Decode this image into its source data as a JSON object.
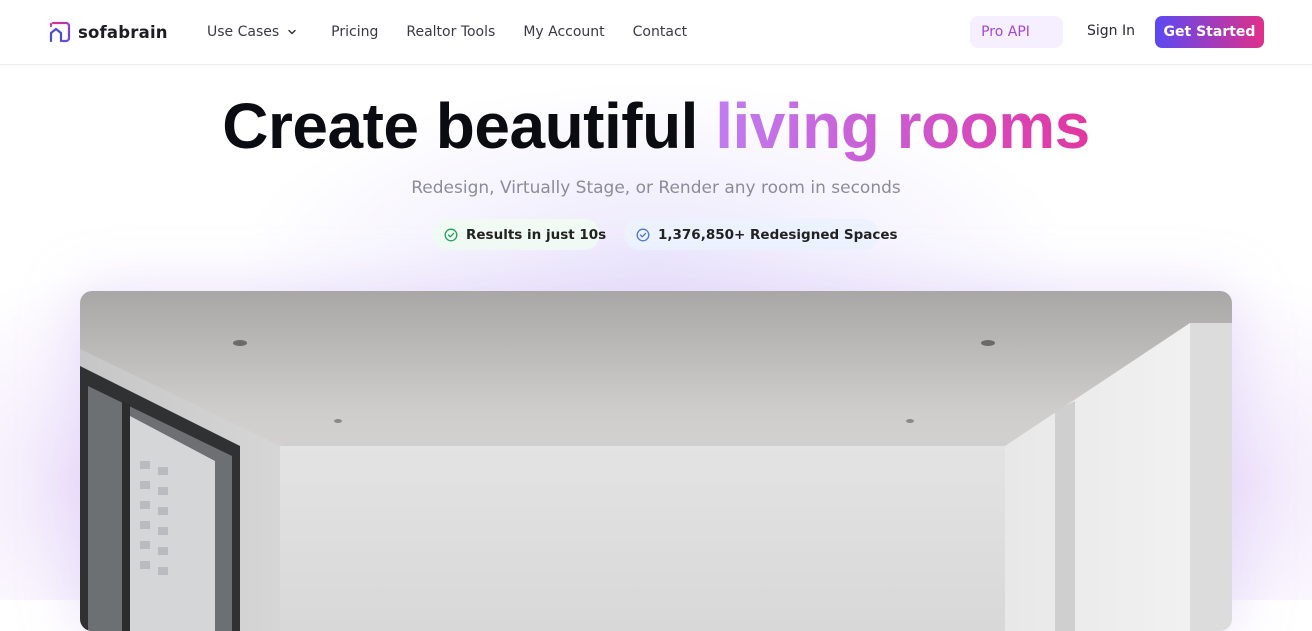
{
  "brand": {
    "name": "sofabrain",
    "logo_icon": "house-logo-icon",
    "accent": "#5a49f2",
    "accent_end": "#e0308a"
  },
  "nav": {
    "items": [
      {
        "label": "Use Cases",
        "has_dropdown": true
      },
      {
        "label": "Pricing"
      },
      {
        "label": "Realtor Tools"
      },
      {
        "label": "My Account"
      },
      {
        "label": "Contact"
      }
    ],
    "pro_api": "Pro API",
    "sign_in": "Sign In",
    "get_started": "Get Started"
  },
  "hero": {
    "title_plain": "Create beautiful",
    "title_highlight": "living rooms",
    "subtitle": "Redesign, Virtually Stage, or Render any room in seconds",
    "badges": [
      {
        "icon": "check-circle-icon",
        "label": "Results in just 10s",
        "color": "#22a35a"
      },
      {
        "icon": "check-circle-icon",
        "label": "1,376,850+ Redesigned Spaces",
        "color": "#4a78d8"
      }
    ],
    "image": "empty-living-room-photo"
  }
}
